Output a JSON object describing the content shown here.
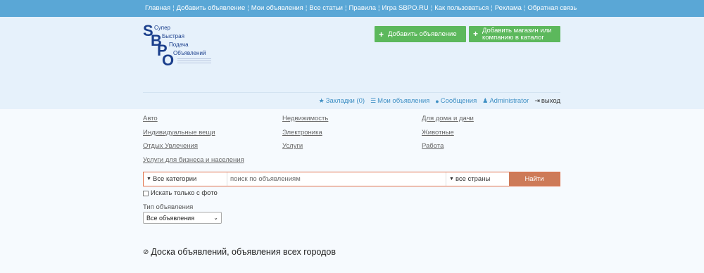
{
  "topnav": {
    "items": [
      "Главная",
      "Добавить объявление",
      "Мои объявления",
      "Все статьи",
      "Правила",
      "Игра SBPO.RU",
      "Как пользоваться",
      "Реклама",
      "Обратная связь"
    ],
    "separator": "¦"
  },
  "logo": {
    "letters": [
      "S",
      "B",
      "P",
      "O"
    ],
    "words": [
      "Супер",
      "Быстрая",
      "Подача",
      "Объявлений"
    ]
  },
  "header": {
    "add_button": "Добавить объявление",
    "shop_button_line1": "Добавить магазин или",
    "shop_button_line2": "компанию в каталог",
    "plus": "+"
  },
  "usernav": {
    "bookmarks": "Закладки (0)",
    "my_ads": "Мои объявления",
    "messages": "Сообщения",
    "user": "Administrator",
    "logout": "выход"
  },
  "categories": [
    "Авто",
    "Недвижимость",
    "Для дома и дачи",
    "Индивидуальные вещи",
    "Электроника",
    "Животные",
    "Отдых Увлечения",
    "Услуги",
    "Работа",
    "Услуги для бизнеса и населения"
  ],
  "search": {
    "category": "Все категории",
    "placeholder": "поиск по объявлениям",
    "country": "все страны",
    "button": "Найти"
  },
  "filters": {
    "photo_only": "Искать только с фото",
    "type_label": "Тип объявления",
    "type_value": "Все объявления"
  },
  "board": {
    "title": "Доска объявлений, объявления всех городов"
  },
  "colors": {
    "topbar": "#5aa7d6",
    "header_bg": "#e6f1fb",
    "green": "#5cb85c",
    "search_border": "#e0714b",
    "search_button": "#cd7a58",
    "link": "#3e8fc4",
    "logo": "#1b3f8c"
  }
}
